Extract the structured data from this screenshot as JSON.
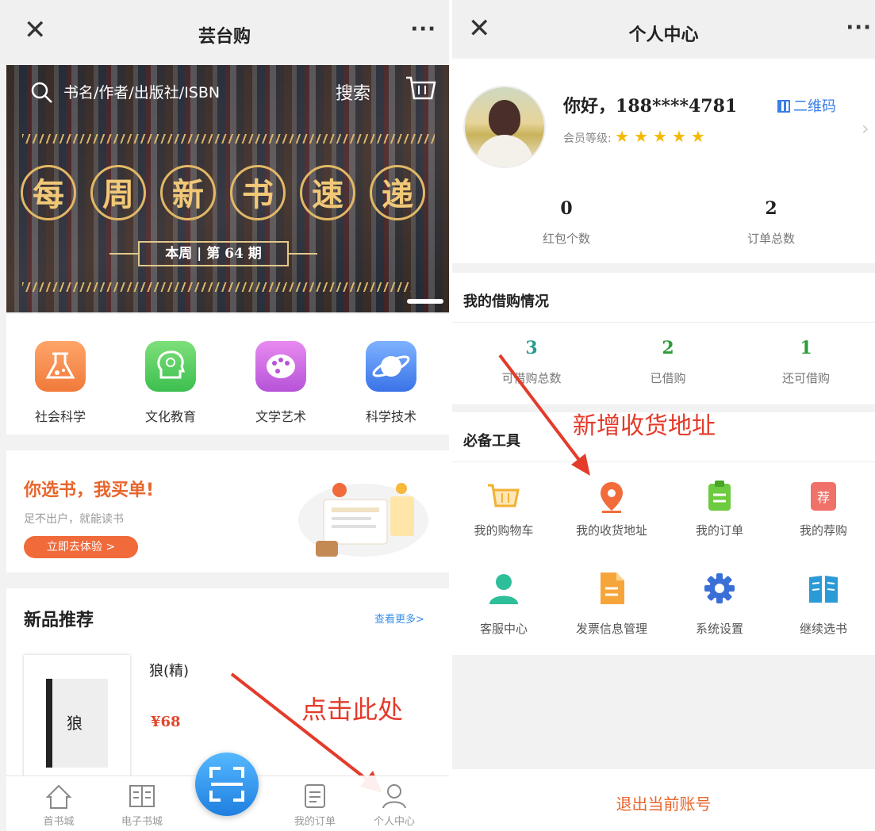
{
  "left": {
    "nav": {
      "close": "✕",
      "title": "芸台购",
      "more": "···"
    },
    "banner": {
      "search_placeholder": "书名/作者/出版社/ISBN",
      "search_btn": "搜索",
      "chars": [
        "每",
        "周",
        "新",
        "书",
        "速",
        "递"
      ],
      "issue": "本周 | 第 64 期"
    },
    "categories": [
      {
        "label": "社会科学"
      },
      {
        "label": "文化教育"
      },
      {
        "label": "文学艺术"
      },
      {
        "label": "科学技术"
      }
    ],
    "promo": {
      "title": "你选书，我买单!",
      "subtitle": "足不出户，就能读书",
      "button": "立即去体验 >"
    },
    "new_products": {
      "title": "新品推荐",
      "more": "查看更多>",
      "book": {
        "title": "狼(精)",
        "price": "¥68",
        "cover_char": "狼"
      }
    },
    "annotation": "点击此处",
    "tabbar": [
      {
        "label": "首书城"
      },
      {
        "label": "电子书城"
      },
      {
        "label": ""
      },
      {
        "label": "我的订单"
      },
      {
        "label": "个人中心"
      }
    ]
  },
  "right": {
    "nav": {
      "close": "✕",
      "title": "个人中心",
      "more": "···"
    },
    "profile": {
      "greeting": "你好，",
      "phone": "188****4781",
      "qr_label": "二维码",
      "level_label": "会员等级:"
    },
    "stats": [
      {
        "value": "0",
        "label": "红包个数"
      },
      {
        "value": "2",
        "label": "订单总数"
      }
    ],
    "borrow": {
      "title": "我的借购情况",
      "items": [
        {
          "value": "3",
          "label": "可借购总数",
          "color": "#2a9d8f"
        },
        {
          "value": "2",
          "label": "已借购",
          "color": "#2e9b3a"
        },
        {
          "value": "1",
          "label": "还可借购",
          "color": "#2e9b3a"
        }
      ]
    },
    "tools": {
      "title": "必备工具",
      "items": [
        {
          "label": "我的购物车",
          "icon": "cart-icon"
        },
        {
          "label": "我的收货地址",
          "icon": "location-pin-icon"
        },
        {
          "label": "我的订单",
          "icon": "clipboard-icon"
        },
        {
          "label": "我的荐购",
          "icon": "recommend-icon"
        },
        {
          "label": "客服中心",
          "icon": "person-icon"
        },
        {
          "label": "发票信息管理",
          "icon": "document-icon"
        },
        {
          "label": "系统设置",
          "icon": "gear-icon"
        },
        {
          "label": "继续选书",
          "icon": "book-icon"
        }
      ]
    },
    "annotation": "新增收货地址",
    "logout": "退出当前账号"
  }
}
